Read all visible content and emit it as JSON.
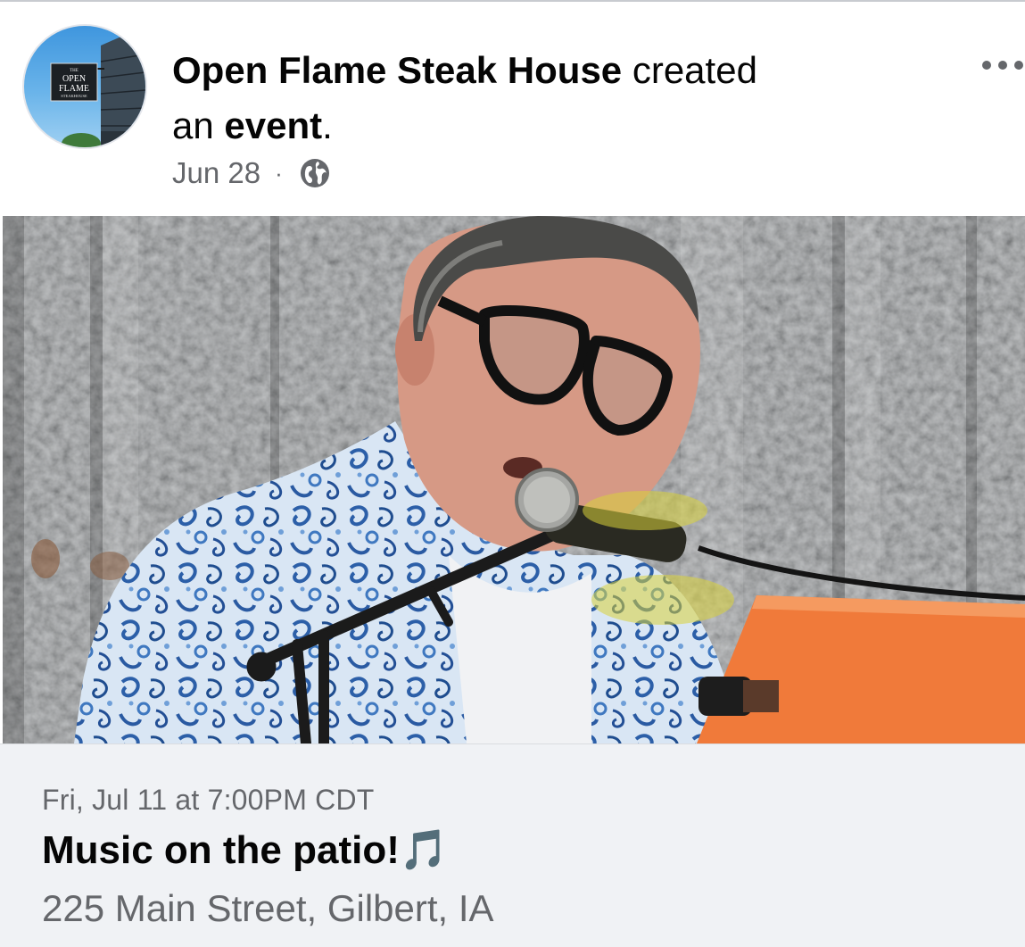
{
  "post": {
    "author": "Open Flame Steak House",
    "action_part1": " created",
    "action_part2": "an ",
    "action_object": "event",
    "action_end": ".",
    "date": "Jun 28",
    "separator": "·",
    "privacy_icon": "globe-icon",
    "avatar_sign": {
      "line1": "THE",
      "line2": "OPEN",
      "line3": "FLAME",
      "line4": "STEAKHOUSE"
    }
  },
  "event": {
    "datetime": "Fri, Jul 11 at 7:00PM CDT",
    "title": "Music on the patio!",
    "title_emoji": "🎵",
    "location": "225 Main Street, Gilbert, IA"
  },
  "colors": {
    "text_primary": "#050505",
    "text_secondary": "#65676b",
    "card_background": "#f0f2f5"
  }
}
